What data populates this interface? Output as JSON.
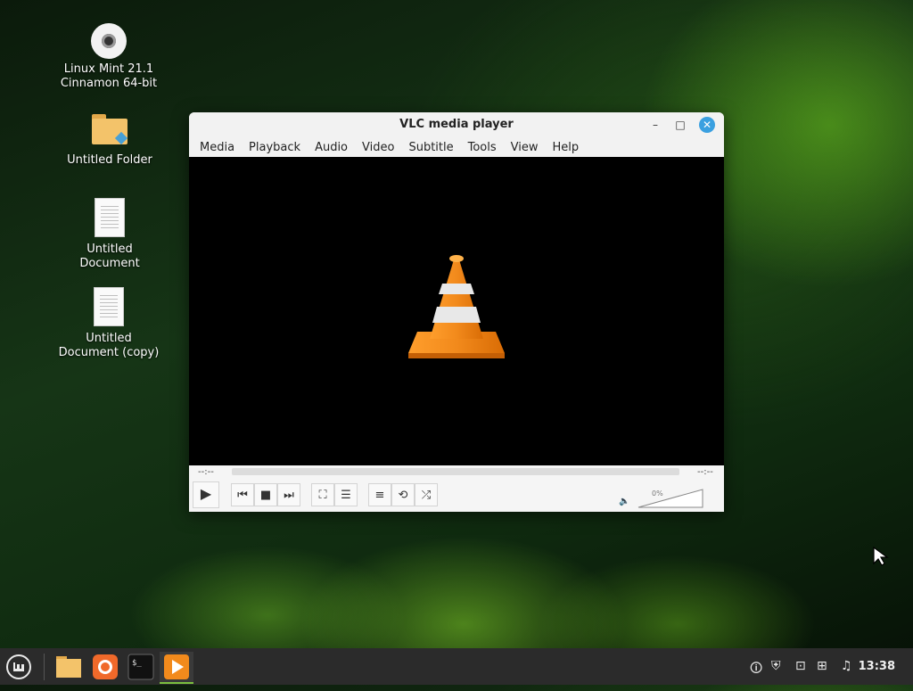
{
  "desktop": {
    "icons": [
      {
        "label_line1": "Linux Mint 21.1",
        "label_line2": "Cinnamon 64-bit",
        "icon": "disc-icon"
      },
      {
        "label_line1": "Untitled Folder",
        "label_line2": "",
        "icon": "folder-icon"
      },
      {
        "label_line1": "Untitled",
        "label_line2": "Document",
        "icon": "document-icon"
      },
      {
        "label_line1": "Untitled",
        "label_line2": "Document (copy)",
        "icon": "document-icon"
      }
    ]
  },
  "vlc": {
    "title": "VLC media player",
    "window_buttons": {
      "minimize": "–",
      "maximize": "□",
      "close": "✕"
    },
    "menu": [
      "Media",
      "Playback",
      "Audio",
      "Video",
      "Subtitle",
      "Tools",
      "View",
      "Help"
    ],
    "time_elapsed": "--:--",
    "time_total": "--:--",
    "volume": "0%",
    "colors": {
      "cone_orange": "#f28a1c",
      "cone_white": "#e8e8e8",
      "video_bg": "#000000"
    }
  },
  "taskbar": {
    "clock": "13:38",
    "active_app": "VLC media player"
  }
}
